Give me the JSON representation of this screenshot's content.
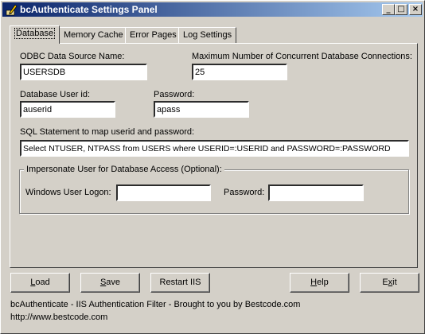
{
  "window": {
    "title": "bcAuthenticate Settings Panel"
  },
  "titlebar": {
    "minimize_glyph": "_",
    "maximize_glyph": "□",
    "close_glyph": "×"
  },
  "tabs": [
    {
      "label": "Database",
      "active": true
    },
    {
      "label": "Memory Cache",
      "active": false
    },
    {
      "label": "Error Pages",
      "active": false
    },
    {
      "label": "Log Settings",
      "active": false
    }
  ],
  "database": {
    "odbc_label": "ODBC Data Source Name:",
    "odbc_value": "USERSDB",
    "max_conn_label": "Maximum Number of Concurrent Database Connections:",
    "max_conn_value": "25",
    "user_label": "Database User id:",
    "user_value": "auserid",
    "password_label": "Password:",
    "password_value": "apass",
    "sql_label": "SQL Statement to map userid and password:",
    "sql_value": "Select NTUSER, NTPASS from USERS where USERID=:USERID and PASSWORD=:PASSWORD",
    "impersonate_title": "Impersonate User for Database Access (Optional):",
    "win_logon_label": "Windows User Logon:",
    "win_logon_value": "",
    "win_password_label": "Password:",
    "win_password_value": ""
  },
  "buttons": {
    "load": {
      "accel": "L",
      "rest": "oad"
    },
    "save": {
      "accel": "S",
      "rest": "ave"
    },
    "restart": "Restart IIS",
    "help": {
      "accel": "H",
      "rest": "elp"
    },
    "exit": {
      "pre": "E",
      "accel": "x",
      "rest": "it"
    }
  },
  "footer": {
    "line1": "bcAuthenticate - IIS Authentication Filter - Brought to you by Bestcode.com",
    "line2": "http://www.bestcode.com"
  }
}
